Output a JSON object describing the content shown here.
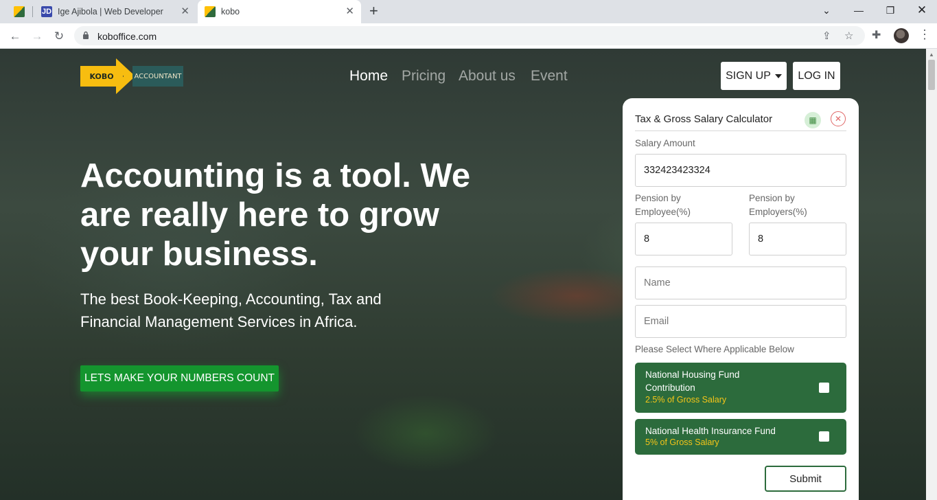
{
  "browser": {
    "tabs": [
      {
        "title": "",
        "favicon": "kobo-favicon"
      },
      {
        "title": "Ige Ajibola | Web Developer",
        "favicon": "jd-favicon",
        "favicon_text": "JD"
      },
      {
        "title": "kobo",
        "favicon": "kobo-favicon",
        "active": true
      }
    ],
    "url": "koboffice.com"
  },
  "site": {
    "logo_left": "KOBO",
    "logo_right": "ACCOUNTANT",
    "nav": [
      "Home",
      "Pricing",
      "About us",
      "Event"
    ],
    "signup": "SIGN UP",
    "login": "LOG IN",
    "hero_title": "Accounting is a tool. We are really here to grow your business.",
    "hero_subtitle": "The best Book-Keeping, Accounting, Tax and Financial Management Services in Africa.",
    "cta": "LETS MAKE YOUR NUMBERS COUNT"
  },
  "calculator": {
    "title": "Tax & Gross Salary Calculator",
    "salary_label": "Salary Amount",
    "salary_value": "332423423324",
    "pension_employee_label": "Pension by Employee(%)",
    "pension_employee_value": "8",
    "pension_employer_label": "Pension by Employers(%)",
    "pension_employer_value": "8",
    "name_placeholder": "Name",
    "email_placeholder": "Email",
    "select_label": "Please Select Where Applicable Below",
    "options": [
      {
        "title": "National Housing Fund Contribution",
        "sub": "2.5% of Gross Salary",
        "checked": false
      },
      {
        "title": "National Health Insurance Fund",
        "sub": "5% of Gross Salary",
        "checked": false
      }
    ],
    "submit": "Submit"
  },
  "colors": {
    "brand_green": "#2c6b3c",
    "cta_green": "#14952e",
    "brand_yellow": "#f7bd10",
    "accent_gold": "#f5c518"
  }
}
